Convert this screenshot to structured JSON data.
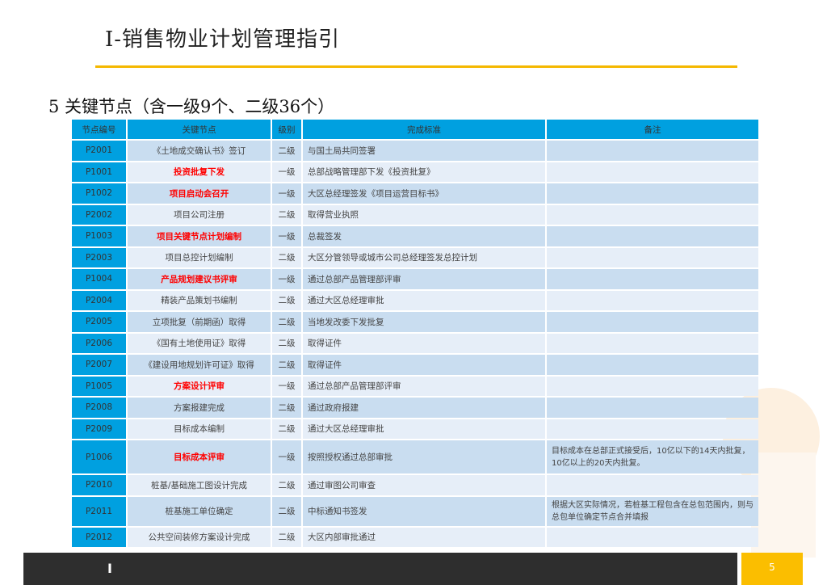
{
  "title": "Ⅰ-销售物业计划管理指引",
  "subtitle": "5   关键节点（含一级9个、二级36个）",
  "table": {
    "headers": [
      "节点编号",
      "关键节点",
      "级别",
      "完成标准",
      "备注"
    ],
    "rows": [
      {
        "id": "P2001",
        "node": "《土地成交确认书》签订",
        "level": "二级",
        "standard": "与国土局共同签署",
        "note": "",
        "key": false
      },
      {
        "id": "P1001",
        "node": "投资批复下发",
        "level": "一级",
        "standard": "总部战略管理部下发《投资批复》",
        "note": "",
        "key": true
      },
      {
        "id": "P1002",
        "node": "项目启动会召开",
        "level": "一级",
        "standard": "大区总经理签发《项目运营目标书》",
        "note": "",
        "key": true
      },
      {
        "id": "P2002",
        "node": "项目公司注册",
        "level": "二级",
        "standard": "取得营业执照",
        "note": "",
        "key": false
      },
      {
        "id": "P1003",
        "node": "项目关键节点计划编制",
        "level": "一级",
        "standard": "总裁签发",
        "note": "",
        "key": true
      },
      {
        "id": "P2003",
        "node": "项目总控计划编制",
        "level": "二级",
        "standard": "大区分管领导或城市公司总经理签发总控计划",
        "note": "",
        "key": false
      },
      {
        "id": "P1004",
        "node": "产品规划建议书评审",
        "level": "一级",
        "standard": "通过总部产品管理部评审",
        "note": "",
        "key": true
      },
      {
        "id": "P2004",
        "node": "精装产品策划书编制",
        "level": "二级",
        "standard": "通过大区总经理审批",
        "note": "",
        "key": false
      },
      {
        "id": "P2005",
        "node": "立项批复（前期函）取得",
        "level": "二级",
        "standard": "当地发改委下发批复",
        "note": "",
        "key": false
      },
      {
        "id": "P2006",
        "node": "《国有土地使用证》取得",
        "level": "二级",
        "standard": "取得证件",
        "note": "",
        "key": false
      },
      {
        "id": "P2007",
        "node": "《建设用地规划许可证》取得",
        "level": "二级",
        "standard": "取得证件",
        "note": "",
        "key": false
      },
      {
        "id": "P1005",
        "node": "方案设计评审",
        "level": "一级",
        "standard": "通过总部产品管理部评审",
        "note": "",
        "key": true
      },
      {
        "id": "P2008",
        "node": "方案报建完成",
        "level": "二级",
        "standard": "通过政府报建",
        "note": "",
        "key": false
      },
      {
        "id": "P2009",
        "node": "目标成本编制",
        "level": "二级",
        "standard": "通过大区总经理审批",
        "note": "",
        "key": false
      },
      {
        "id": "P1006",
        "node": "目标成本评审",
        "level": "一级",
        "standard": "按照授权通过总部审批",
        "note": "目标成本在总部正式接受后，10亿以下的14天内批复，10亿以上的20天内批复。",
        "key": true
      },
      {
        "id": "P2010",
        "node": "桩基/基础施工图设计完成",
        "level": "二级",
        "standard": "通过审图公司审查",
        "note": "",
        "key": false
      },
      {
        "id": "P2011",
        "node": "桩基施工单位确定",
        "level": "二级",
        "standard": "中标通知书签发",
        "note": "根据大区实际情况，若桩基工程包含在总包范围内，则与总包单位确定节点合并填报",
        "key": false
      },
      {
        "id": "P2012",
        "node": "公共空间装修方案设计完成",
        "level": "二级",
        "standard": "大区内部审批通过",
        "note": "",
        "key": false
      }
    ]
  },
  "footer": {
    "section": "I",
    "page": "5"
  }
}
